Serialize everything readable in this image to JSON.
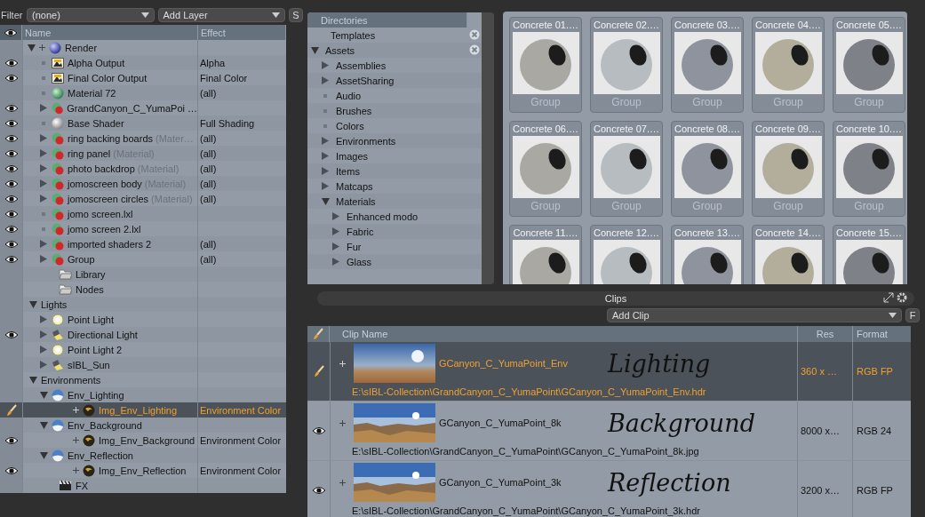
{
  "shader_tree": {
    "filter_label": "Filter",
    "filter_value": "(none)",
    "add_layer": "Add Layer",
    "s_button": "S",
    "columns": [
      "Name",
      "Effect"
    ],
    "items": [
      {
        "name": "Render",
        "kind": "render",
        "visible": false,
        "expanded": true,
        "selected": false,
        "children": [
          {
            "name": "Alpha Output",
            "effect": "Alpha",
            "kind": "output",
            "visible": true,
            "selected": false
          },
          {
            "name": "Final Color Output",
            "effect": "Final Color",
            "kind": "output",
            "visible": true,
            "selected": false
          },
          {
            "name": "Material 72",
            "effect": "(all)",
            "kind": "material",
            "visible": false,
            "selected": false
          },
          {
            "name": "GrandCanyon_C_YumaPoi …",
            "kind": "mask",
            "visible": true,
            "expanded": false,
            "selected": false
          },
          {
            "name": "Base Shader",
            "effect": "Full Shading",
            "kind": "shader",
            "visible": true,
            "selected": false
          },
          {
            "name": "ring backing boards",
            "note": "(Mater…",
            "effect": "(all)",
            "kind": "mask",
            "visible": true,
            "expanded": false,
            "selected": false
          },
          {
            "name": "ring panel",
            "note": "(Material)",
            "effect": "(all)",
            "kind": "mask",
            "visible": true,
            "expanded": false,
            "selected": false
          },
          {
            "name": "photo backdrop",
            "note": "(Material)",
            "effect": "(all)",
            "kind": "mask",
            "visible": true,
            "expanded": false,
            "selected": false
          },
          {
            "name": "jomoscreen body",
            "note": "(Material)",
            "effect": "(all)",
            "kind": "mask",
            "visible": true,
            "expanded": false,
            "selected": false
          },
          {
            "name": "jomoscreen circles",
            "note": "(Material)",
            "effect": "(all)",
            "kind": "mask",
            "visible": true,
            "expanded": false,
            "selected": false
          },
          {
            "name": "jomo screen.lxl",
            "kind": "mask",
            "visible": true,
            "selected": false
          },
          {
            "name": "jomo screen 2.lxl",
            "kind": "mask",
            "visible": true,
            "selected": false
          },
          {
            "name": "imported shaders 2",
            "effect": "(all)",
            "kind": "mask",
            "visible": true,
            "expanded": false,
            "selected": false
          },
          {
            "name": "Group",
            "effect": "(all)",
            "kind": "mask",
            "visible": true,
            "expanded": false,
            "selected": false
          }
        ]
      },
      {
        "name": "Library",
        "kind": "folder",
        "visible": false,
        "selected": false
      },
      {
        "name": "Nodes",
        "kind": "folder",
        "visible": false,
        "selected": false
      },
      {
        "name": "Lights",
        "kind": "heading",
        "visible": false,
        "expanded": true,
        "selected": false,
        "children": [
          {
            "name": "Point Light",
            "kind": "point-light",
            "visible": false,
            "expanded": false,
            "selected": false
          },
          {
            "name": "Directional Light",
            "kind": "directional-light",
            "visible": true,
            "expanded": false,
            "selected": false
          },
          {
            "name": "Point Light 2",
            "kind": "point-light",
            "visible": false,
            "expanded": false,
            "selected": false
          },
          {
            "name": "sIBL_Sun",
            "kind": "directional-light",
            "visible": false,
            "expanded": false,
            "selected": false
          }
        ]
      },
      {
        "name": "Environments",
        "kind": "heading",
        "visible": false,
        "expanded": true,
        "selected": false,
        "children": [
          {
            "name": "Env_Lighting",
            "kind": "environment",
            "visible": false,
            "expanded": true,
            "selected": false,
            "children": [
              {
                "name": "Img_Env_Lighting",
                "effect": "Environment Color",
                "kind": "image",
                "visible": true,
                "selected": true
              }
            ]
          },
          {
            "name": "Env_Background",
            "kind": "environment",
            "visible": false,
            "expanded": true,
            "selected": false,
            "children": [
              {
                "name": "Img_Env_Background",
                "effect": "Environment Color",
                "kind": "image",
                "visible": true,
                "selected": false
              }
            ]
          },
          {
            "name": "Env_Reflection",
            "kind": "environment",
            "visible": false,
            "expanded": true,
            "selected": false,
            "children": [
              {
                "name": "Img_Env_Reflection",
                "effect": "Environment Color",
                "kind": "image",
                "visible": true,
                "selected": false
              }
            ]
          }
        ]
      },
      {
        "name": "FX",
        "kind": "fx",
        "visible": false,
        "selected": false
      }
    ]
  },
  "directories": {
    "title": "Directories",
    "items": [
      {
        "name": "Templates",
        "closable": true
      },
      {
        "name": "Assets",
        "expanded": true,
        "closable": true,
        "children": [
          {
            "name": "Assemblies",
            "expanded": false,
            "closable": false
          },
          {
            "name": "AssetSharing",
            "expanded": false,
            "closable": false
          },
          {
            "name": "Audio",
            "closable": false
          },
          {
            "name": "Brushes",
            "closable": false
          },
          {
            "name": "Colors",
            "closable": false
          },
          {
            "name": "Environments",
            "expanded": false,
            "closable": false
          },
          {
            "name": "Images",
            "expanded": false,
            "closable": false
          },
          {
            "name": "Items",
            "expanded": false,
            "closable": false
          },
          {
            "name": "Matcaps",
            "expanded": false,
            "closable": false
          },
          {
            "name": "Materials",
            "expanded": true,
            "closable": false,
            "children": [
              {
                "name": "Enhanced modo",
                "expanded": false,
                "closable": false
              },
              {
                "name": "Fabric",
                "expanded": false,
                "closable": false
              },
              {
                "name": "Fur",
                "expanded": false,
                "closable": false
              },
              {
                "name": "Glass",
                "expanded": false,
                "closable": false
              }
            ]
          }
        ]
      }
    ]
  },
  "presets": [
    {
      "label": "Concrete 01.…",
      "footer": "Group"
    },
    {
      "label": "Concrete 02.…",
      "footer": "Group"
    },
    {
      "label": "Concrete 03.…",
      "footer": "Group"
    },
    {
      "label": "Concrete 04.…",
      "footer": "Group"
    },
    {
      "label": "Concrete 05.…",
      "footer": "Group"
    },
    {
      "label": "Concrete 06.…",
      "footer": "Group"
    },
    {
      "label": "Concrete 07.…",
      "footer": "Group"
    },
    {
      "label": "Concrete 08.…",
      "footer": "Group"
    },
    {
      "label": "Concrete 09.…",
      "footer": "Group"
    },
    {
      "label": "Concrete 10.…",
      "footer": "Group"
    },
    {
      "label": "Concrete 11.…"
    },
    {
      "label": "Concrete 12.…"
    },
    {
      "label": "Concrete 13.…"
    },
    {
      "label": "Concrete 14.…"
    },
    {
      "label": "Concrete 15.…"
    }
  ],
  "clips": {
    "title": "Clips",
    "add_clip": "Add Clip",
    "f_button": "F",
    "columns": [
      "Clip Name",
      "Res",
      "Format"
    ],
    "rows": [
      {
        "kind": "blurred",
        "name": "GCanyon_C_YumaPoint_Env",
        "note": "Lighting",
        "res": "360 x …",
        "format": "RGB FP",
        "path": "E:\\sIBL-Collection\\GrandCanyon_C_YumaPoint\\GCanyon_C_YumaPoint_Env.hdr",
        "selected": true
      },
      {
        "kind": "sharp",
        "name": "GCanyon_C_YumaPoint_8k",
        "note": "Background",
        "res": "8000 x…",
        "format": "RGB 24",
        "path": "E:\\sIBL-Collection\\GrandCanyon_C_YumaPoint\\GCanyon_C_YumaPoint_8k.jpg",
        "selected": false
      },
      {
        "kind": "sharp",
        "name": "GCanyon_C_YumaPoint_3k",
        "note": "Reflection",
        "res": "3200 x…",
        "format": "RGB FP",
        "path": "E:\\sIBL-Collection\\GrandCanyon_C_YumaPoint\\GCanyon_C_YumaPoint_3k.hdr",
        "selected": false
      }
    ]
  }
}
